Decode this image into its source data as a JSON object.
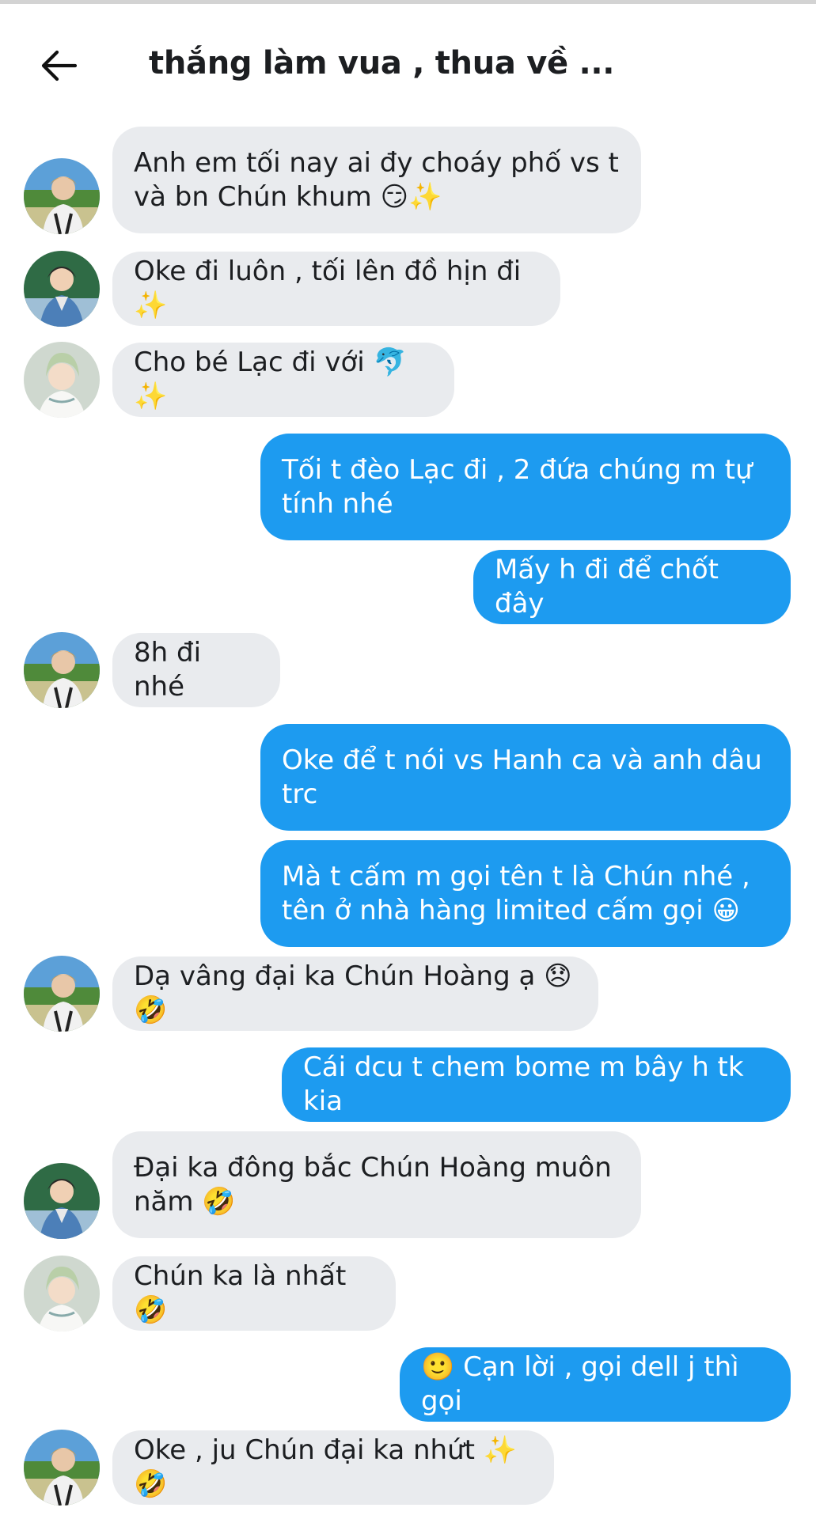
{
  "header": {
    "back_icon": "arrow-left-icon",
    "title": "thắng làm vua , thua về ..."
  },
  "colors": {
    "incoming_bubble": "#e9ebee",
    "outgoing_bubble": "#1d9bf0",
    "outgoing_text": "#ffffff"
  },
  "messages": [
    {
      "side": "in",
      "sender": "avatar-a",
      "text": "Anh em tối nay ai đy choáy phố vs t và bn Chún khum 😏✨"
    },
    {
      "side": "in",
      "sender": "avatar-b",
      "text": "Oke đi luôn , tối lên đồ hịn đi ✨"
    },
    {
      "side": "in",
      "sender": "avatar-c",
      "text": "Cho bé Lạc đi với 🐬✨"
    },
    {
      "side": "out",
      "text": "Tối t đèo Lạc đi , 2 đứa chúng m tự tính nhé"
    },
    {
      "side": "out",
      "text": "Mấy h đi để chốt đây"
    },
    {
      "side": "in",
      "sender": "avatar-a",
      "text": "8h đi nhé"
    },
    {
      "side": "out",
      "text": "Oke để t nói vs Hanh ca và anh dâu trc"
    },
    {
      "side": "out",
      "text": "Mà t cấm m gọi tên t là Chún nhé , tên ở nhà hàng limited cấm gọi 😀"
    },
    {
      "side": "in",
      "sender": "avatar-a",
      "text": "Dạ vâng đại ka Chún Hoàng ạ 😞🤣"
    },
    {
      "side": "out",
      "text": "Cái dcu t chem bome m bây h tk kia"
    },
    {
      "side": "in",
      "sender": "avatar-b",
      "text": "Đại ka đông bắc Chún Hoàng muôn năm 🤣"
    },
    {
      "side": "in",
      "sender": "avatar-c",
      "text": "Chún ka là nhất 🤣"
    },
    {
      "side": "out",
      "text": "🙂 Cạn lời , gọi dell j thì gọi"
    },
    {
      "side": "in",
      "sender": "avatar-a",
      "text": "Oke , ju Chún đại ka nhứt ✨🤣"
    }
  ]
}
